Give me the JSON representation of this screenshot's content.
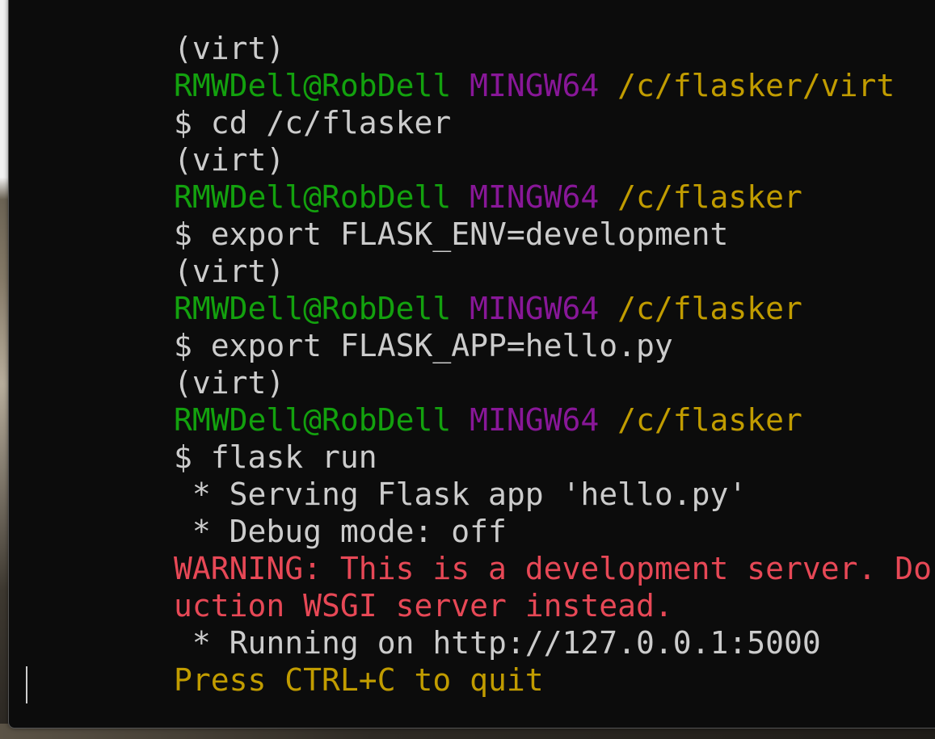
{
  "terminal": {
    "lines": [
      {
        "segments": [
          {
            "text": "(virt)",
            "color": "white"
          }
        ]
      },
      {
        "segments": [
          {
            "text": "RMWDell@RobDell",
            "color": "green"
          },
          {
            "text": " ",
            "color": "white"
          },
          {
            "text": "MINGW64",
            "color": "purple"
          },
          {
            "text": " ",
            "color": "white"
          },
          {
            "text": "/c/flasker/virt",
            "color": "yellow"
          }
        ]
      },
      {
        "segments": [
          {
            "text": "$ cd /c/flasker",
            "color": "white"
          }
        ]
      },
      {
        "segments": [
          {
            "text": "(virt)",
            "color": "white"
          }
        ]
      },
      {
        "segments": [
          {
            "text": "RMWDell@RobDell",
            "color": "green"
          },
          {
            "text": " ",
            "color": "white"
          },
          {
            "text": "MINGW64",
            "color": "purple"
          },
          {
            "text": " ",
            "color": "white"
          },
          {
            "text": "/c/flasker",
            "color": "yellow"
          }
        ]
      },
      {
        "segments": [
          {
            "text": "$ export FLASK_ENV=development",
            "color": "white"
          }
        ]
      },
      {
        "segments": [
          {
            "text": "(virt)",
            "color": "white"
          }
        ]
      },
      {
        "segments": [
          {
            "text": "RMWDell@RobDell",
            "color": "green"
          },
          {
            "text": " ",
            "color": "white"
          },
          {
            "text": "MINGW64",
            "color": "purple"
          },
          {
            "text": " ",
            "color": "white"
          },
          {
            "text": "/c/flasker",
            "color": "yellow"
          }
        ]
      },
      {
        "segments": [
          {
            "text": "$ export FLASK_APP=hello.py",
            "color": "white"
          }
        ]
      },
      {
        "segments": [
          {
            "text": "(virt)",
            "color": "white"
          }
        ]
      },
      {
        "segments": [
          {
            "text": "RMWDell@RobDell",
            "color": "green"
          },
          {
            "text": " ",
            "color": "white"
          },
          {
            "text": "MINGW64",
            "color": "purple"
          },
          {
            "text": " ",
            "color": "white"
          },
          {
            "text": "/c/flasker",
            "color": "yellow"
          }
        ]
      },
      {
        "segments": [
          {
            "text": "$ flask run",
            "color": "white"
          }
        ]
      },
      {
        "segments": [
          {
            "text": " * Serving Flask app 'hello.py'",
            "color": "white"
          }
        ]
      },
      {
        "segments": [
          {
            "text": " * Debug mode: off",
            "color": "white"
          }
        ]
      },
      {
        "segments": [
          {
            "text": "WARNING: This is a development server. Do not use",
            "color": "red"
          }
        ]
      },
      {
        "segments": [
          {
            "text": "uction WSGI server instead.",
            "color": "red"
          }
        ]
      },
      {
        "segments": [
          {
            "text": " * Running on http://127.0.0.1:5000",
            "color": "white"
          }
        ]
      },
      {
        "segments": [
          {
            "text": "Press CTRL+C to quit",
            "color": "yellow"
          }
        ]
      }
    ]
  },
  "colors": {
    "background": "#0c0c0c",
    "white": "#cccccc",
    "green": "#13a10e",
    "purple": "#881798",
    "yellow": "#c19c00",
    "red": "#e74856"
  }
}
